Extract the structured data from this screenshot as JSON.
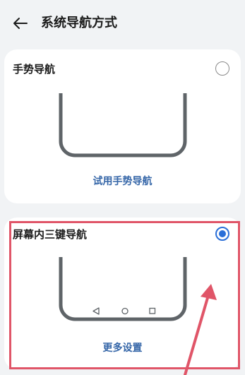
{
  "header": {
    "title": "系统导航方式",
    "back_icon": "arrow-left-icon"
  },
  "options": [
    {
      "label": "手势导航",
      "selected": false,
      "link": "试用手势导航"
    },
    {
      "label": "屏幕内三键导航",
      "selected": true,
      "link": "更多设置",
      "nav_icons": [
        "triangle-back-icon",
        "circle-home-icon",
        "square-recents-icon"
      ]
    }
  ],
  "colors": {
    "background": "#f1f3f5",
    "card": "#ffffff",
    "accent": "#2a6fd8",
    "link": "#3566a8",
    "annotation": "#e05568",
    "phone_outline": "#5f6468"
  }
}
